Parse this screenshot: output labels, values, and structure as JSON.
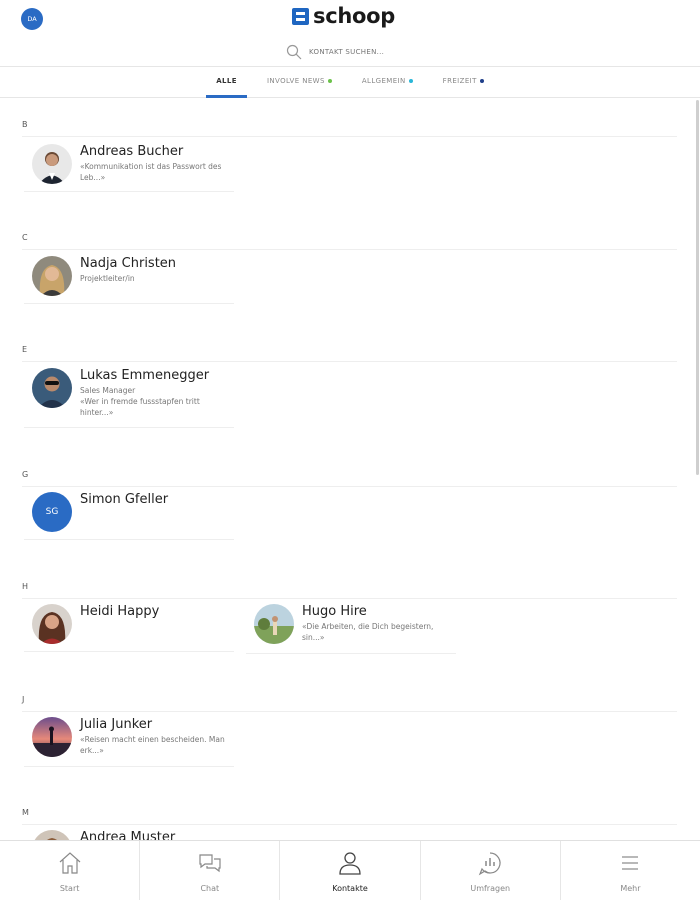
{
  "header": {
    "avatar_initials": "DA",
    "logo_text": "schoop",
    "search_placeholder": "KONTAKT SUCHEN..."
  },
  "tabs": [
    {
      "label": "ALLE",
      "active": true,
      "dot_color": ""
    },
    {
      "label": "INVOLVE NEWS",
      "active": false,
      "dot_color": "#6bc24a"
    },
    {
      "label": "ALLGEMEIN",
      "active": false,
      "dot_color": "#29b6d8"
    },
    {
      "label": "FREIZEIT",
      "active": false,
      "dot_color": "#1f3f8a"
    }
  ],
  "sections": [
    {
      "letter": "B",
      "contacts": [
        {
          "name": "Andreas Bucher",
          "subtitle": "«Kommunikation ist das Passwort des Leb...»",
          "avatar": "photo-man-suit"
        }
      ]
    },
    {
      "letter": "C",
      "contacts": [
        {
          "name": "Nadja Christen",
          "subtitle": "Projektleiter/in",
          "avatar": "photo-woman-blonde"
        }
      ]
    },
    {
      "letter": "E",
      "contacts": [
        {
          "name": "Lukas Emmenegger",
          "subtitle": "Sales Manager\n«Wer in fremde fussstapfen tritt hinter...»",
          "avatar": "photo-man-sunglasses"
        }
      ]
    },
    {
      "letter": "G",
      "contacts": [
        {
          "name": "Simon Gfeller",
          "subtitle": "",
          "avatar": "SG"
        }
      ]
    },
    {
      "letter": "H",
      "contacts": [
        {
          "name": "Heidi Happy",
          "subtitle": "",
          "avatar": "photo-woman-brunette"
        },
        {
          "name": "Hugo Hire",
          "subtitle": "«Die Arbeiten, die Dich begeistern, sin...»",
          "avatar": "photo-landscape"
        }
      ]
    },
    {
      "letter": "J",
      "contacts": [
        {
          "name": "Julia Junker",
          "subtitle": "«Reisen macht einen bescheiden. Man erk...»",
          "avatar": "photo-sunset"
        }
      ]
    },
    {
      "letter": "M",
      "contacts": [
        {
          "name": "Andrea Muster",
          "subtitle": "",
          "avatar": "photo-woman"
        }
      ]
    }
  ],
  "bottom_nav": [
    {
      "label": "Start",
      "icon": "home-icon",
      "active": false
    },
    {
      "label": "Chat",
      "icon": "chat-icon",
      "active": false
    },
    {
      "label": "Kontakte",
      "icon": "person-icon",
      "active": true
    },
    {
      "label": "Umfragen",
      "icon": "poll-icon",
      "active": false
    },
    {
      "label": "Mehr",
      "icon": "menu-icon",
      "active": false
    }
  ]
}
